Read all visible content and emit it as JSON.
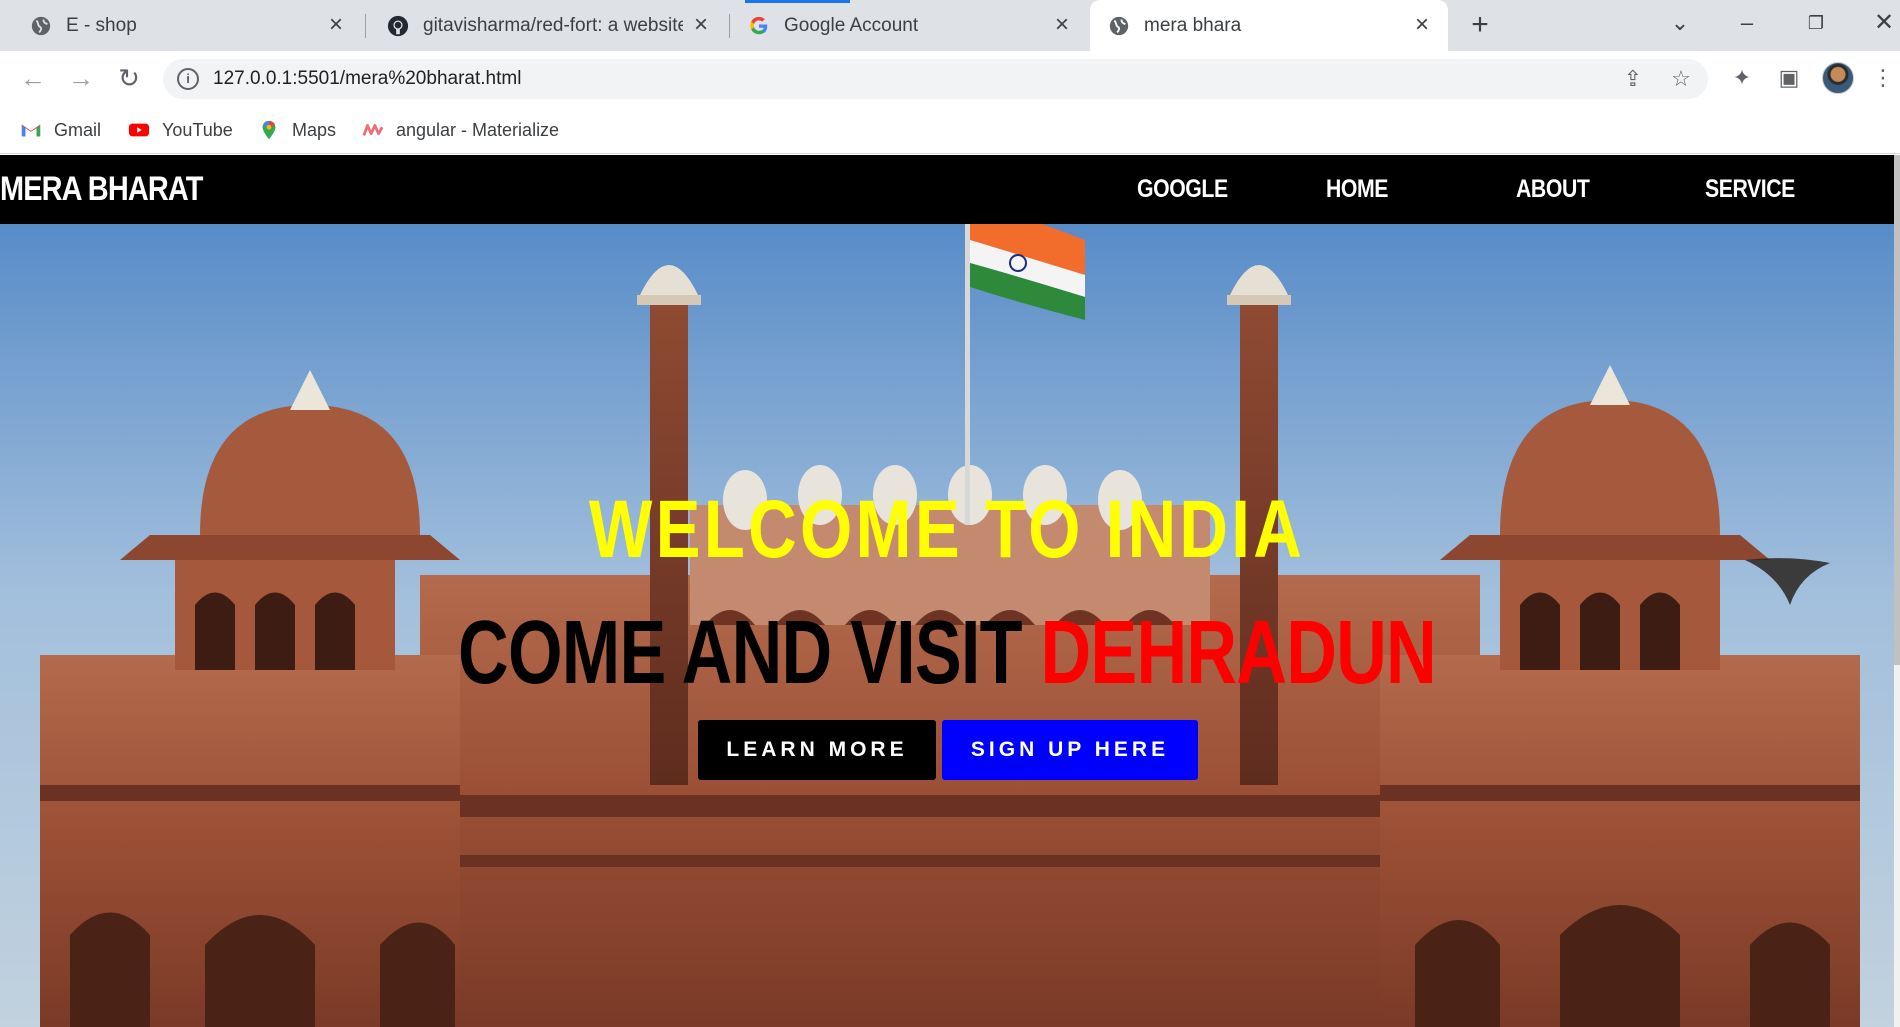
{
  "browser": {
    "tabs": [
      {
        "title": "E - shop",
        "icon": "globe-icon"
      },
      {
        "title": "gitavisharma/red-fort: a website",
        "icon": "github-icon"
      },
      {
        "title": "Google Account",
        "icon": "google-icon"
      },
      {
        "title": "mera bhara",
        "icon": "globe-icon",
        "active": true
      }
    ],
    "new_tab": "+",
    "url": "127.0.0.1:5501/mera%20bharat.html",
    "bookmarks": [
      {
        "label": "Gmail",
        "icon": "gmail-icon"
      },
      {
        "label": "YouTube",
        "icon": "youtube-icon"
      },
      {
        "label": "Maps",
        "icon": "maps-icon"
      },
      {
        "label": "angular - Materialize",
        "icon": "materialize-icon"
      }
    ]
  },
  "site": {
    "brand": "MERA BHARAT",
    "nav": [
      "GOOGLE",
      "HOME",
      "ABOUT",
      "SERVICE"
    ],
    "hero": {
      "headline": "WELCOME TO INDIA",
      "subheadline_prefix": "COME AND VISIT",
      "subheadline_accent": "DEHRADUN",
      "primary_button": "LEARN MORE",
      "secondary_button": "SIGN UP HERE"
    },
    "colors": {
      "headline": "#ffff00",
      "accent": "#ff0000",
      "primary_button": "#000000",
      "secondary_button": "#0000ff",
      "navbar": "#000000"
    }
  }
}
